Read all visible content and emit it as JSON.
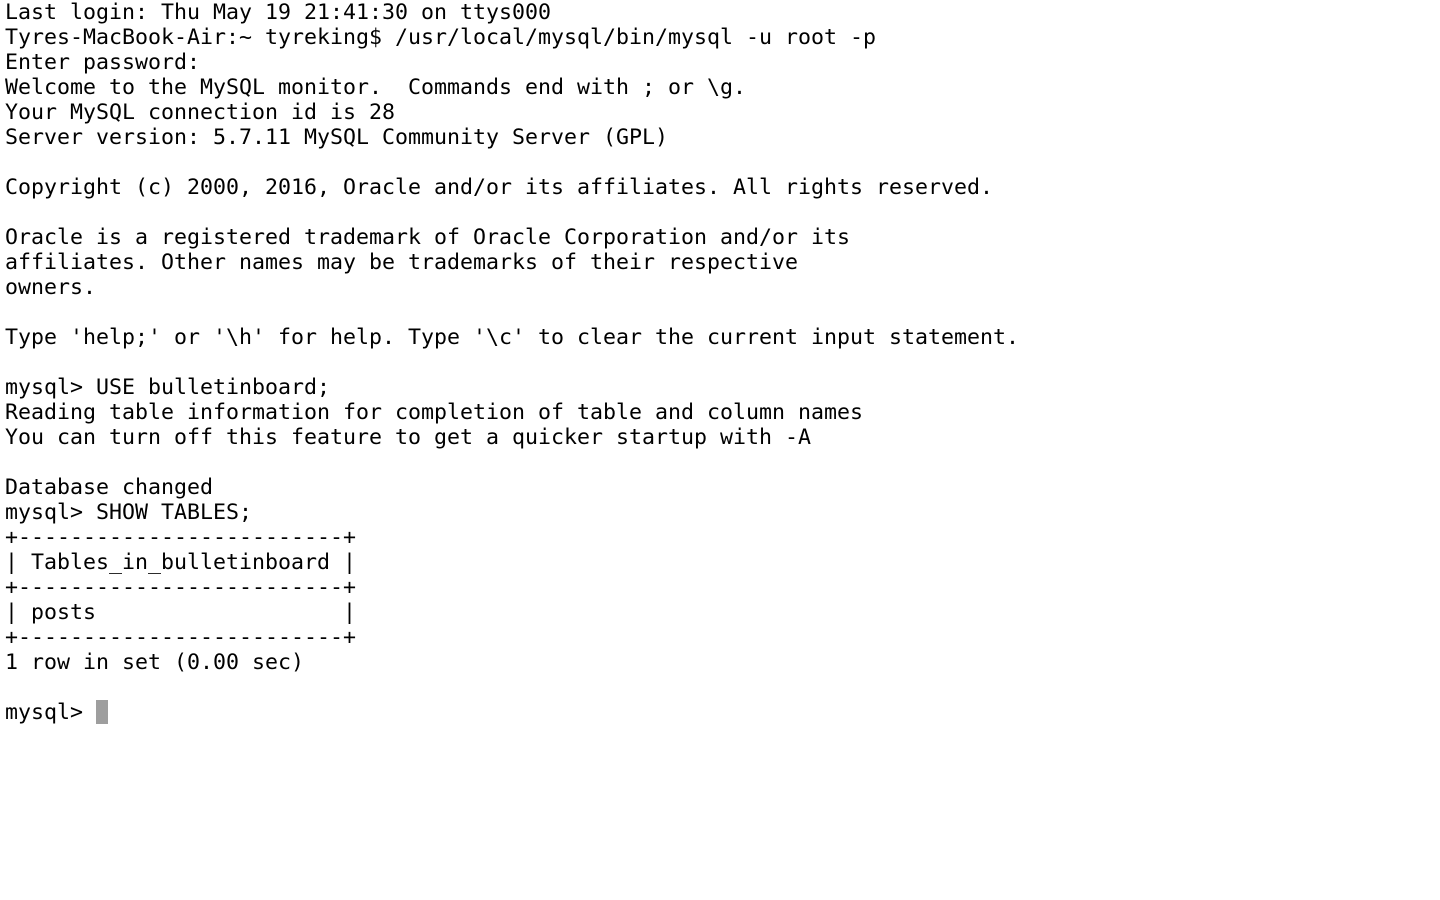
{
  "terminal": {
    "background": "#ffffff",
    "foreground": "#000000",
    "cursor_color": "#9e9e9e",
    "lines": [
      "Last login: Thu May 19 21:41:30 on ttys000",
      "Tyres-MacBook-Air:~ tyreking$ /usr/local/mysql/bin/mysql -u root -p",
      "Enter password:",
      "Welcome to the MySQL monitor.  Commands end with ; or \\g.",
      "Your MySQL connection id is 28",
      "Server version: 5.7.11 MySQL Community Server (GPL)",
      "",
      "Copyright (c) 2000, 2016, Oracle and/or its affiliates. All rights reserved.",
      "",
      "Oracle is a registered trademark of Oracle Corporation and/or its",
      "affiliates. Other names may be trademarks of their respective",
      "owners.",
      "",
      "Type 'help;' or '\\h' for help. Type '\\c' to clear the current input statement.",
      "",
      "mysql> USE bulletinboard;",
      "Reading table information for completion of table and column names",
      "You can turn off this feature to get a quicker startup with -A",
      "",
      "Database changed",
      "mysql> SHOW TABLES;",
      "+-------------------------+",
      "| Tables_in_bulletinboard |",
      "+-------------------------+",
      "| posts                   |",
      "+-------------------------+",
      "1 row in set (0.00 sec)",
      ""
    ],
    "prompt": "mysql>"
  }
}
